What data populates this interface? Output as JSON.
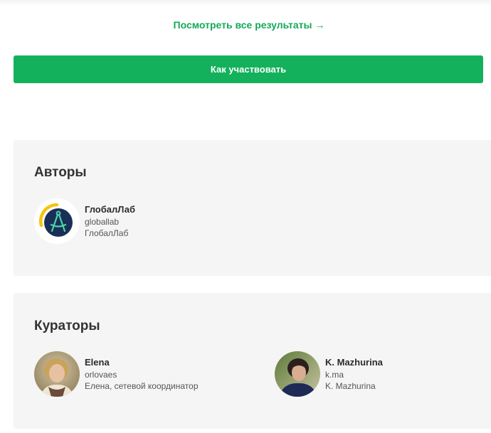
{
  "links": {
    "all_results": "Посмотреть все результаты",
    "all_results_arrow": "→"
  },
  "cta": {
    "label": "Как участвовать"
  },
  "authors": {
    "title": "Авторы",
    "people": [
      {
        "name": "ГлобалЛаб",
        "login": "globallab",
        "role": "ГлобалЛаб",
        "avatar_icon": "compass-logo-icon"
      }
    ]
  },
  "curators": {
    "title": "Кураторы",
    "people": [
      {
        "name": "Elena",
        "login": "orlovaes",
        "role": "Елена, сетевой координатор",
        "avatar_icon": "user-photo"
      },
      {
        "name": "K. Mazhurina",
        "login": "k.ma",
        "role": "K. Mazhurina",
        "avatar_icon": "user-photo"
      }
    ]
  },
  "colors": {
    "accent_green": "#14b15c",
    "link_green": "#14a85a",
    "panel_bg": "#f5f5f5",
    "logo_navy": "#1a2f57",
    "logo_yellow": "#f5c40f",
    "logo_mint": "#4fd2a6"
  }
}
